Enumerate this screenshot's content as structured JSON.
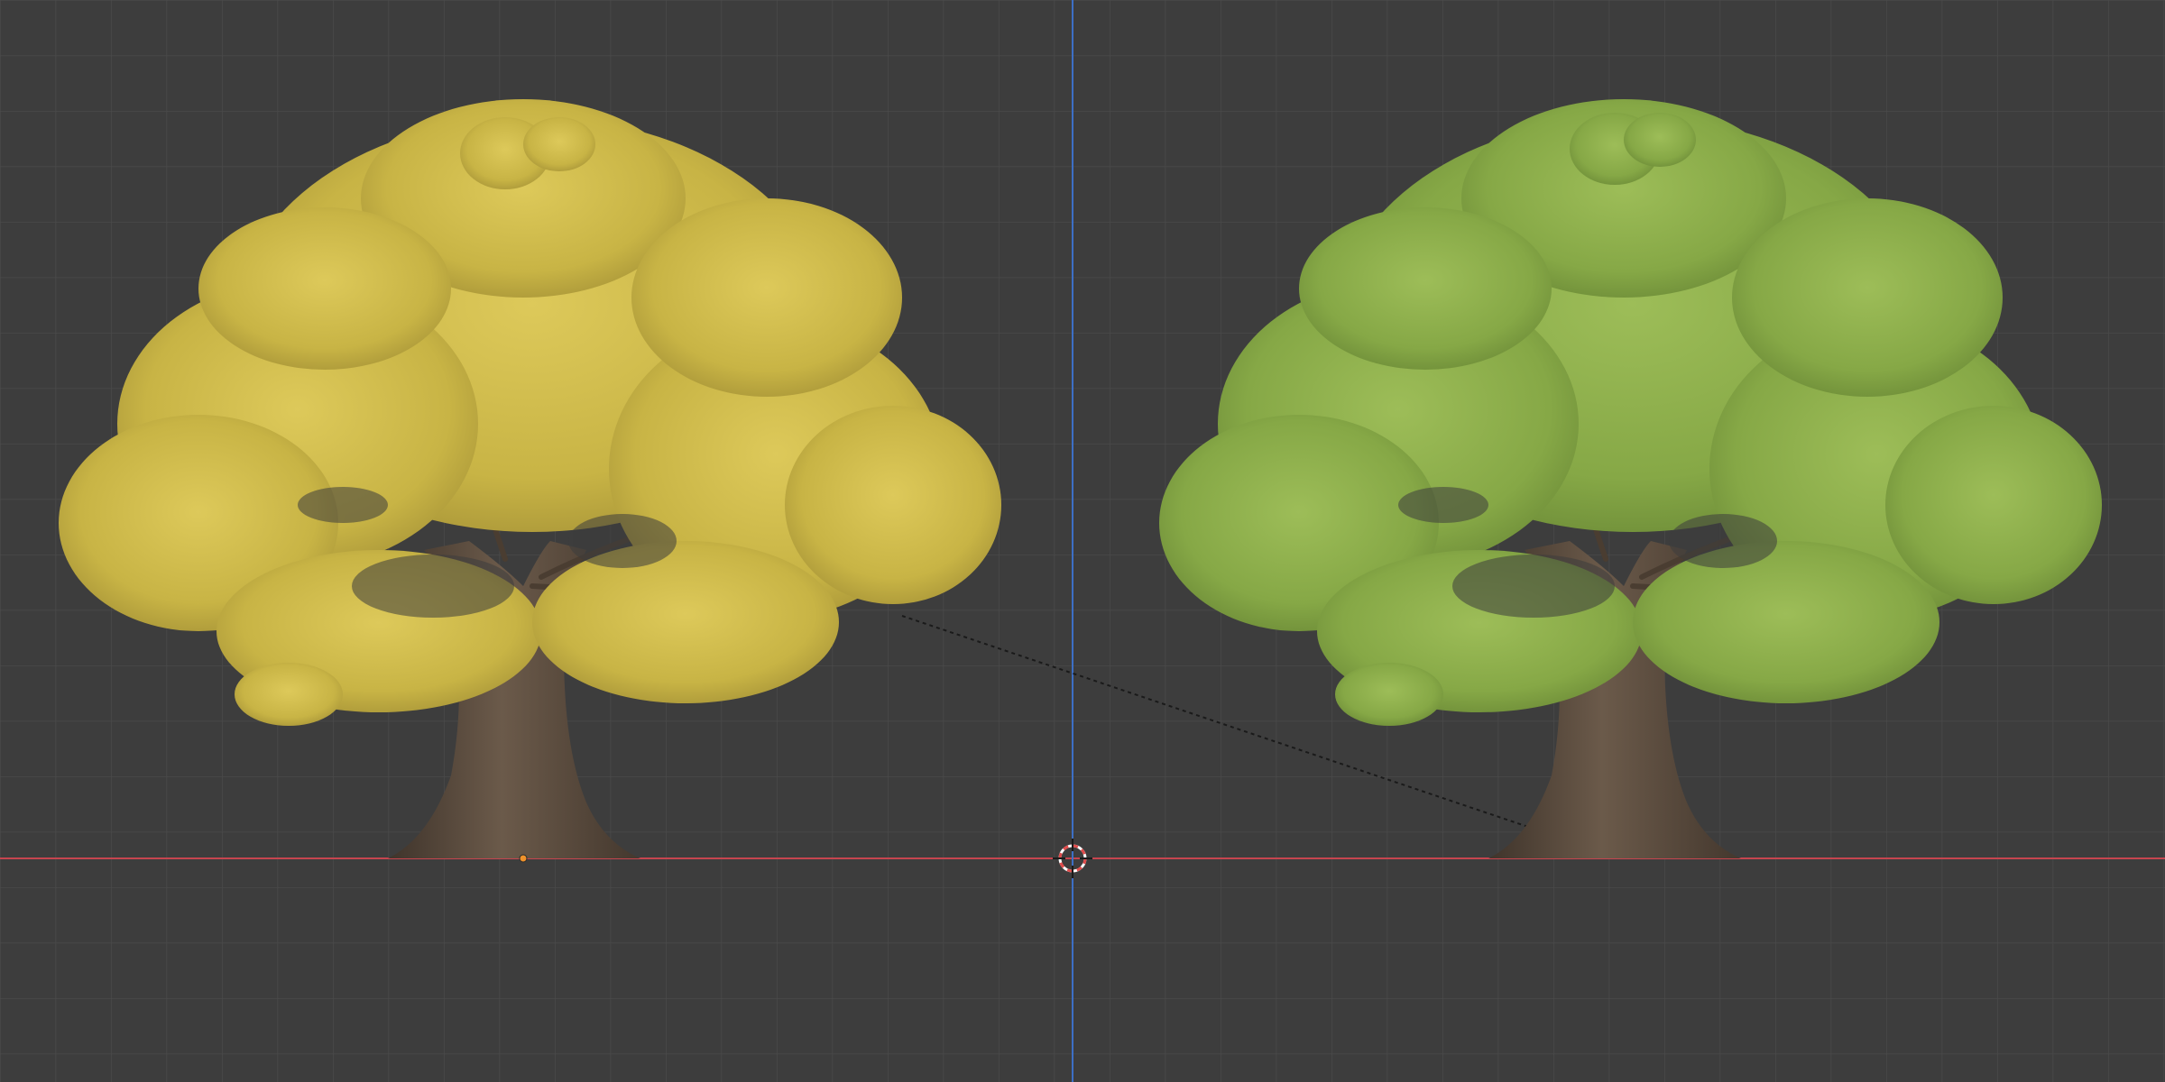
{
  "viewport": {
    "background_color": "#3d3d3d",
    "grid_color": "#4a4a4a",
    "x_axis_color": "#c6454f",
    "z_axis_color": "#3d6fc5"
  },
  "objects": [
    {
      "name": "tree-yellow",
      "foliage_color": "#d2c24e",
      "trunk_color": "#5a4a3c"
    },
    {
      "name": "tree-green",
      "foliage_color": "#8fb24b",
      "trunk_color": "#5a4a3c"
    }
  ],
  "cursor": {
    "icon": "3d-cursor-icon",
    "color": "#e04b4b"
  },
  "origin_marker": {
    "icon": "object-origin-icon",
    "color": "#f0922b"
  },
  "relationship_line": {
    "style": "dashed",
    "color": "#1a1a1a"
  }
}
